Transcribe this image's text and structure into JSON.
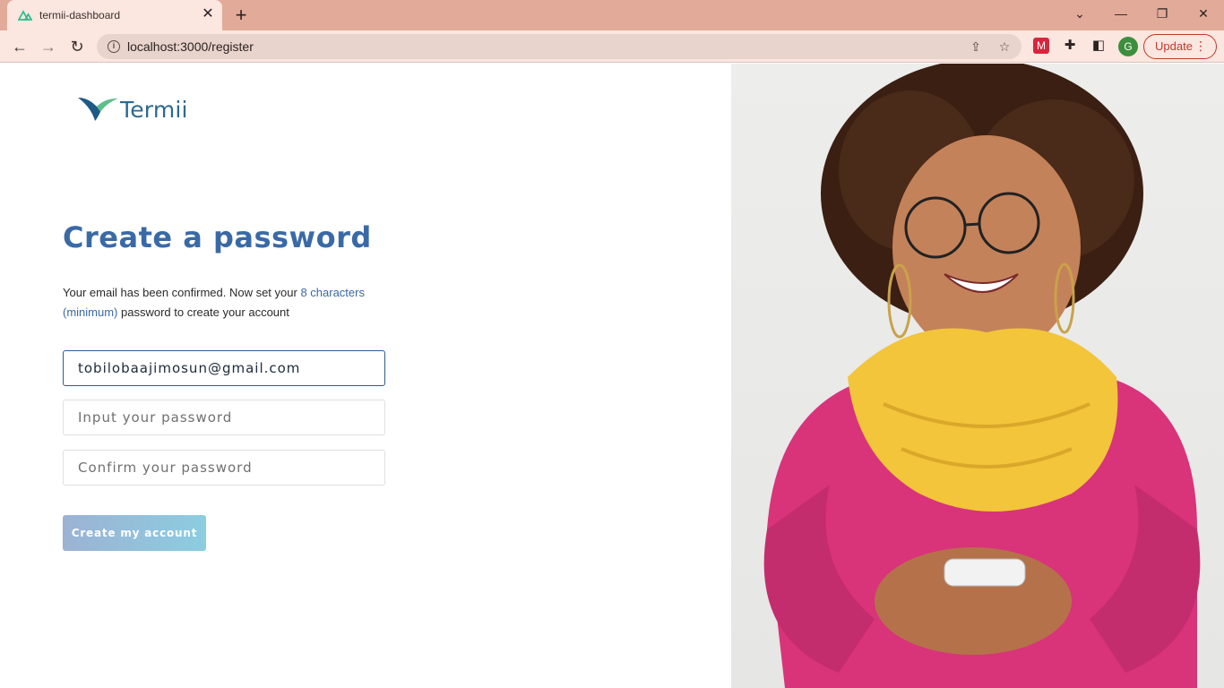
{
  "browser": {
    "tab_title": "termii-dashboard",
    "url": "localhost:3000/register",
    "update_label": "Update",
    "avatar_letter": "G"
  },
  "page": {
    "logo_text": "Termii",
    "title": "Create a password",
    "desc_part1": "Your email has been confirmed. Now set your ",
    "desc_highlight": "8 characters (minimum)",
    "desc_part2": " password to create your account",
    "email_value": "tobilobaajimosun@gmail.com",
    "password_placeholder": "Input your password",
    "confirm_placeholder": "Confirm your password",
    "submit_label": "Create my account"
  },
  "colors": {
    "accent": "#3a6aa6",
    "tabstrip": "#e2aa99",
    "toolbar": "#fbe6e0",
    "update_red": "#c0392b"
  }
}
